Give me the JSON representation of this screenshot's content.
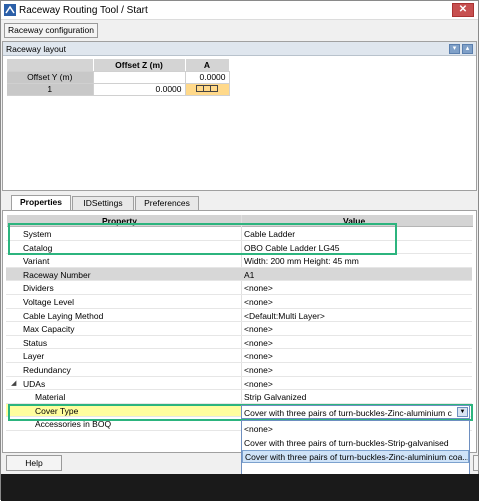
{
  "window": {
    "title": "Raceway Routing Tool / Start",
    "close_label": "✕"
  },
  "toolbar": {
    "raceway_config_label": "Raceway configuration"
  },
  "layout": {
    "header": "Raceway layout",
    "col_offset_z": "Offset Z (m)",
    "col_a": "A",
    "row_offset_y": "Offset Y (m)",
    "row_offset_y_value": "0.0000",
    "row1_label": "1",
    "row1_value": "0.0000",
    "cell_icon": "cable-ladder-icon"
  },
  "tabs": [
    {
      "label": "Properties",
      "active": true
    },
    {
      "label": "IDSettings",
      "active": false
    },
    {
      "label": "Preferences",
      "active": false
    }
  ],
  "properties": {
    "col_property": "Property",
    "col_value": "Value",
    "rows": [
      {
        "name": "System",
        "value": "Cable Ladder"
      },
      {
        "name": "Catalog",
        "value": "OBO Cable Ladder LG45"
      },
      {
        "name": "Variant",
        "value": "Width: 200 mm  Height: 45 mm"
      },
      {
        "name": "Raceway Number",
        "value": "A1"
      },
      {
        "name": "Dividers",
        "value": "<none>"
      },
      {
        "name": "Voltage Level",
        "value": "<none>"
      },
      {
        "name": "Cable Laying Method",
        "value": "<Default:Multi Layer>"
      },
      {
        "name": "Max Capacity",
        "value": "<none>"
      },
      {
        "name": "Status",
        "value": "<none>"
      },
      {
        "name": "Layer",
        "value": "<none>"
      },
      {
        "name": "Redundancy",
        "value": "<none>"
      },
      {
        "name": "UDAs",
        "value": "<none>"
      },
      {
        "name": "Material",
        "value": "Strip Galvanized"
      },
      {
        "name": "Cover Type",
        "value": ""
      },
      {
        "name": "Accessories in BOQ",
        "value": ""
      }
    ]
  },
  "cover_type_combo": {
    "value": "Cover with three pairs of turn-buckles-Zinc-aluminium c",
    "options": [
      "<none>",
      "Cover with three pairs of turn-buckles-Strip-galvanised",
      "Cover with three pairs of turn-buckles-Zinc-aluminium coa..."
    ],
    "selected_index": 2
  },
  "footer": {
    "help_label": "Help"
  },
  "colors": {
    "highlight_green": "#2cb47e",
    "cell_selected": "#ffd98a",
    "row_yellow": "#fffe9e"
  }
}
